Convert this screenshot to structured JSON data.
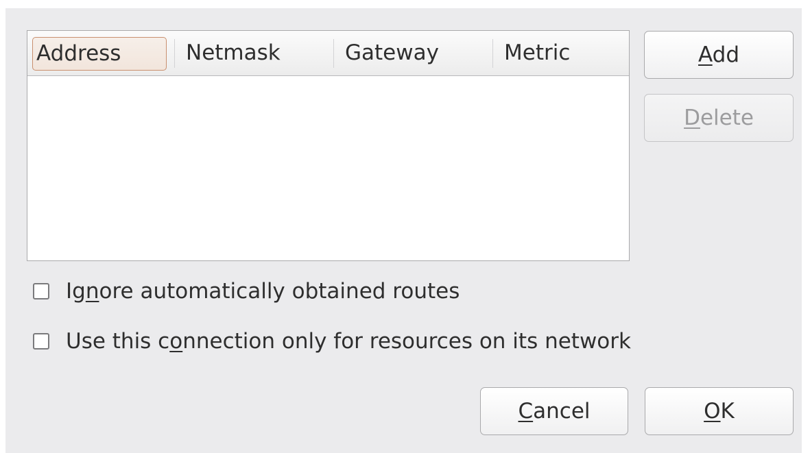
{
  "routes_table": {
    "columns": [
      "Address",
      "Netmask",
      "Gateway",
      "Metric"
    ],
    "active_column": "Address",
    "rows": []
  },
  "buttons": {
    "add": {
      "before": "",
      "mnemonic": "A",
      "after": "dd",
      "enabled": true
    },
    "delete": {
      "before": "",
      "mnemonic": "D",
      "after": "elete",
      "enabled": false
    },
    "cancel": {
      "before": "",
      "mnemonic": "C",
      "after": "ancel",
      "enabled": true
    },
    "ok": {
      "before": "",
      "mnemonic": "O",
      "after": "K",
      "enabled": true
    }
  },
  "options": {
    "ignore_routes": {
      "before": "Ig",
      "mnemonic": "n",
      "after": "ore automatically obtained routes",
      "checked": false
    },
    "only_network": {
      "before": "Use this c",
      "mnemonic": "o",
      "after": "nnection only for resources on its network",
      "checked": false
    }
  },
  "colors": {
    "dialog_bg": "#ebebed",
    "active_header_border": "#c98f6e",
    "disabled_text": "#9c9c9e"
  }
}
